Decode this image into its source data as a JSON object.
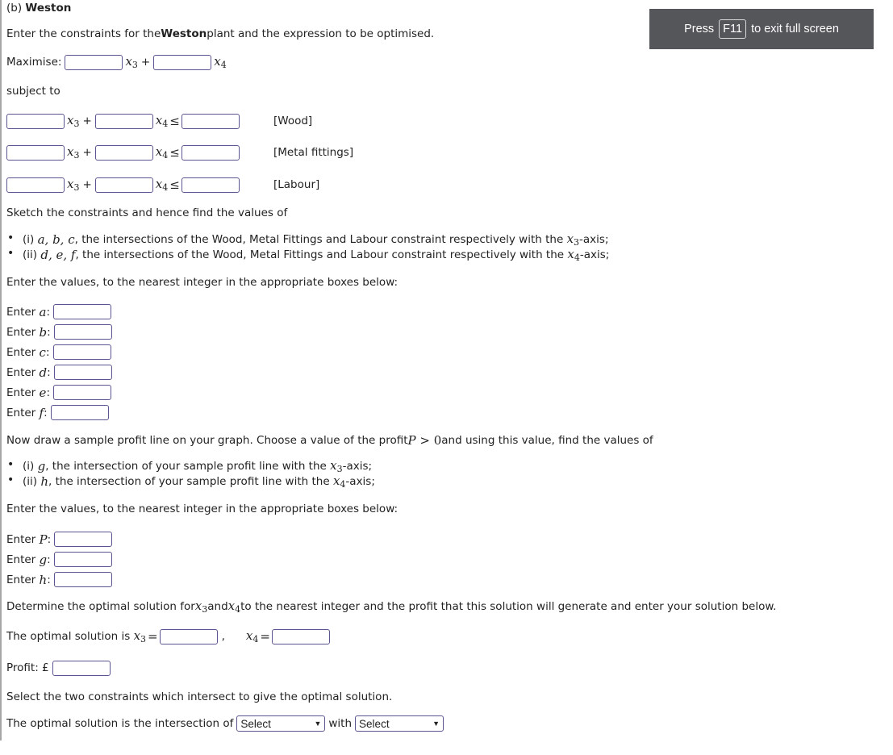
{
  "part_label": "(b)",
  "plant_name": "Weston",
  "intro": {
    "before": "Enter the constraints for the ",
    "plant": "Weston",
    "after": " plant and the expression to be optimised."
  },
  "objective": {
    "label": "Maximise:",
    "var1": "x",
    "sub1": "3",
    "plus": "+",
    "var2": "x",
    "sub2": "4",
    "coef1": "",
    "coef2": ""
  },
  "subject_to": "subject to",
  "constraints": [
    {
      "name": "[Wood]",
      "coef1": "",
      "coef2": "",
      "rhs": ""
    },
    {
      "name": "[Metal fittings]",
      "coef1": "",
      "coef2": "",
      "rhs": ""
    },
    {
      "name": "[Labour]",
      "coef1": "",
      "coef2": "",
      "rhs": ""
    }
  ],
  "symbols": {
    "leq": "≤",
    "eq": "=",
    "plus": "+"
  },
  "sketch_text": "Sketch the constraints and hence find the values of",
  "intersections_list": [
    {
      "prefix": "(i) ",
      "vars": "a, b, c",
      "text": ", the intersections of the Wood, Metal Fittings and Labour constraint respectively with the ",
      "axis_sub": "3",
      "suffix": "-axis;"
    },
    {
      "prefix": "(ii) ",
      "vars": "d, e, f",
      "text": ", the intersections of the Wood, Metal Fittings and Labour constraint respectively with the ",
      "axis_sub": "4",
      "suffix": "-axis;"
    }
  ],
  "enter_values_text": "Enter the values, to the nearest integer in the appropriate boxes below:",
  "enter_prefix": "Enter ",
  "intersection_inputs": [
    {
      "var": "a",
      "value": ""
    },
    {
      "var": "b",
      "value": ""
    },
    {
      "var": "c",
      "value": ""
    },
    {
      "var": "d",
      "value": ""
    },
    {
      "var": "e",
      "value": ""
    },
    {
      "var": "f",
      "value": ""
    }
  ],
  "profit_line_text": {
    "before": "Now draw a sample profit line on your graph. Choose a value of the profit ",
    "math": "(P > 0)",
    "after": " and using this value, find the values of"
  },
  "profit_list": [
    {
      "prefix": "(i) ",
      "var": "g",
      "text": ", the intersection of your sample profit line with the ",
      "axis_sub": "3",
      "suffix": "-axis;"
    },
    {
      "prefix": "(ii) ",
      "var": "h",
      "text": ", the intersection of your sample profit line with the ",
      "axis_sub": "4",
      "suffix": "-axis;"
    }
  ],
  "profit_inputs": [
    {
      "var": "P",
      "value": ""
    },
    {
      "var": "g",
      "value": ""
    },
    {
      "var": "h",
      "value": ""
    }
  ],
  "determine_text": {
    "before": "Determine the optimal solution for ",
    "and": " and ",
    "after": " to the nearest integer and the profit that this solution will generate and enter your solution below."
  },
  "optimal": {
    "label": "The optimal solution is ",
    "x3": "",
    "x4": "",
    "comma": ","
  },
  "profit": {
    "label": "Profit: £",
    "value": ""
  },
  "select_two_text": "Select the two constraints which intersect to give the optimal solution.",
  "intersection_select": {
    "label": "The optimal solution is the intersection of",
    "with": "with",
    "select1": "Select",
    "select2": "Select"
  },
  "fullscreen_banner": {
    "press": "Press",
    "key": "F11",
    "rest": "to exit full screen"
  }
}
